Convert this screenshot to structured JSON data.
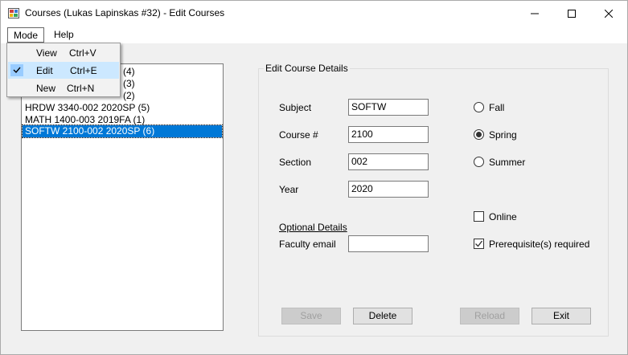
{
  "window": {
    "title": "Courses (Lukas Lapinskas #32) - Edit Courses"
  },
  "menu": {
    "mode_label": "Mode",
    "help_label": "Help",
    "mode_items": [
      {
        "label": "View",
        "shortcut": "Ctrl+V",
        "checked": false
      },
      {
        "label": "Edit",
        "shortcut": "Ctrl+E",
        "checked": true
      },
      {
        "label": "New",
        "shortcut": "Ctrl+N",
        "checked": false
      }
    ]
  },
  "course_list": {
    "items": [
      {
        "text": "(4)",
        "selected": false,
        "obscured": true
      },
      {
        "text": "(3)",
        "selected": false,
        "obscured": true
      },
      {
        "text": "(2)",
        "selected": false,
        "obscured": true
      },
      {
        "text": "HRDW 3340-002 2020SP (5)",
        "selected": false
      },
      {
        "text": "MATH 1400-003 2019FA (1)",
        "selected": false
      },
      {
        "text": "SOFTW 2100-002 2020SP (6)",
        "selected": true
      }
    ]
  },
  "details": {
    "group_title": "Edit Course Details",
    "subject_label": "Subject",
    "subject_value": "SOFTW",
    "course_label": "Course #",
    "course_value": "2100",
    "section_label": "Section",
    "section_value": "002",
    "year_label": "Year",
    "year_value": "2020",
    "optional_label": "Optional Details",
    "email_label": "Faculty email",
    "email_value": ""
  },
  "terms": {
    "fall_label": "Fall",
    "spring_label": "Spring",
    "summer_label": "Summer",
    "selected": "Spring"
  },
  "options": {
    "online_label": "Online",
    "online_checked": false,
    "prereq_label": "Prerequisite(s) required",
    "prereq_checked": true
  },
  "buttons": {
    "save_label": "Save",
    "delete_label": "Delete",
    "reload_label": "Reload",
    "exit_label": "Exit"
  },
  "colors": {
    "selection": "#0078d7",
    "menu_highlight": "#cce8ff",
    "window_bg": "#f0f0f0"
  }
}
